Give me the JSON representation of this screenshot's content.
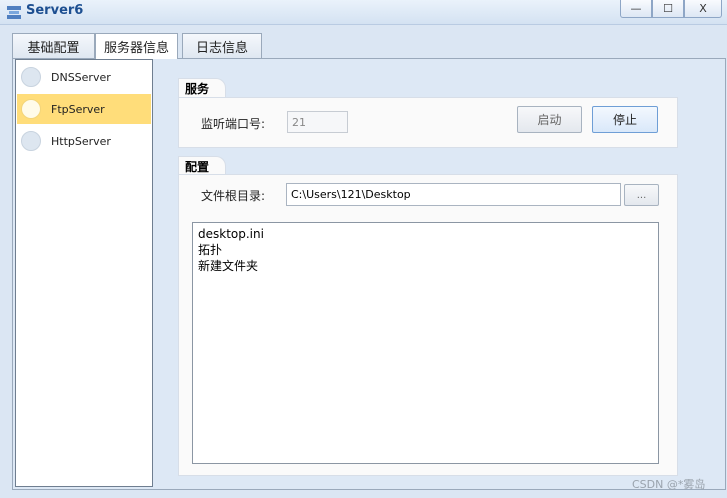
{
  "window": {
    "title": "Server6",
    "controls": {
      "minimize": "—",
      "maximize": "☐",
      "close": "X"
    }
  },
  "tabs": [
    {
      "label": "基础配置"
    },
    {
      "label": "服务器信息",
      "selected": true
    },
    {
      "label": "日志信息"
    }
  ],
  "server_list": [
    {
      "label": "DNSServer",
      "selected": false
    },
    {
      "label": "FtpServer",
      "selected": true
    },
    {
      "label": "HttpServer",
      "selected": false
    }
  ],
  "service": {
    "heading": "服务",
    "port_label": "监听端口号:",
    "port_value": "21",
    "start_label": "启动",
    "stop_label": "停止"
  },
  "config": {
    "heading": "配置",
    "root_label": "文件根目录:",
    "root_value": "C:\\Users\\121\\Desktop",
    "browse_label": "...",
    "files": [
      "desktop.ini",
      "拓扑",
      "新建文件夹"
    ]
  },
  "watermark": "CSDN @*雾岛",
  "colors": {
    "selected_item": "#ffdd7a",
    "title_text": "#1d4f91"
  }
}
